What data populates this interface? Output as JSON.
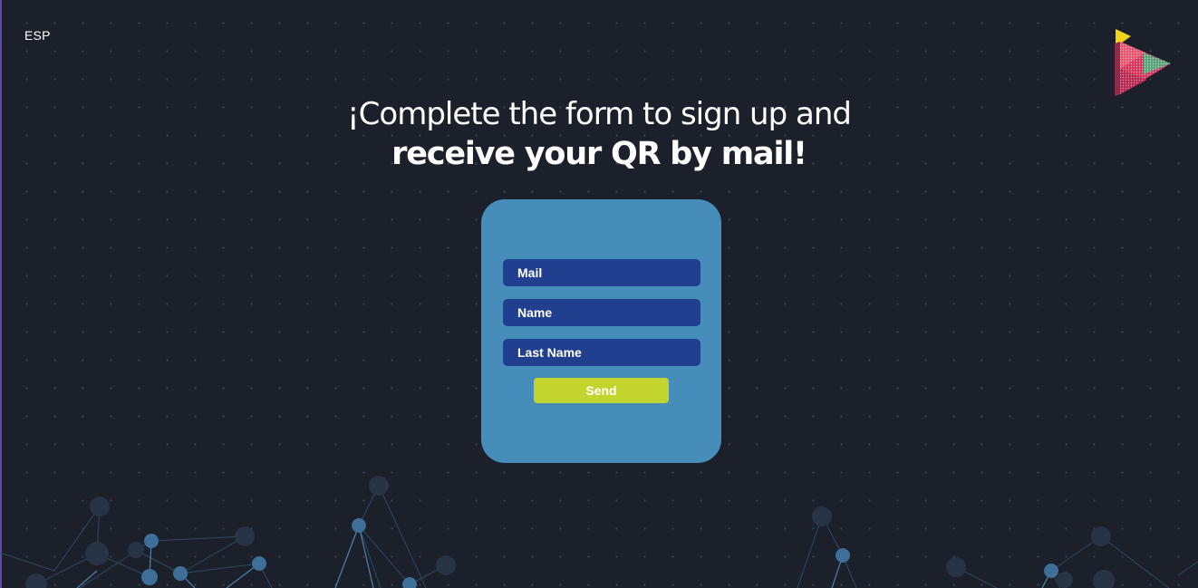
{
  "header": {
    "language_toggle": "ESP"
  },
  "headline": {
    "line1": "¡Complete the form to sign up and",
    "line2": "receive your QR by mail!"
  },
  "form": {
    "mail_placeholder": "Mail",
    "name_placeholder": "Name",
    "last_name_placeholder": "Last Name",
    "send_label": "Send"
  },
  "colors": {
    "background": "#1b202b",
    "card": "#468dba",
    "input": "#213f8f",
    "button": "#c3d42f"
  }
}
